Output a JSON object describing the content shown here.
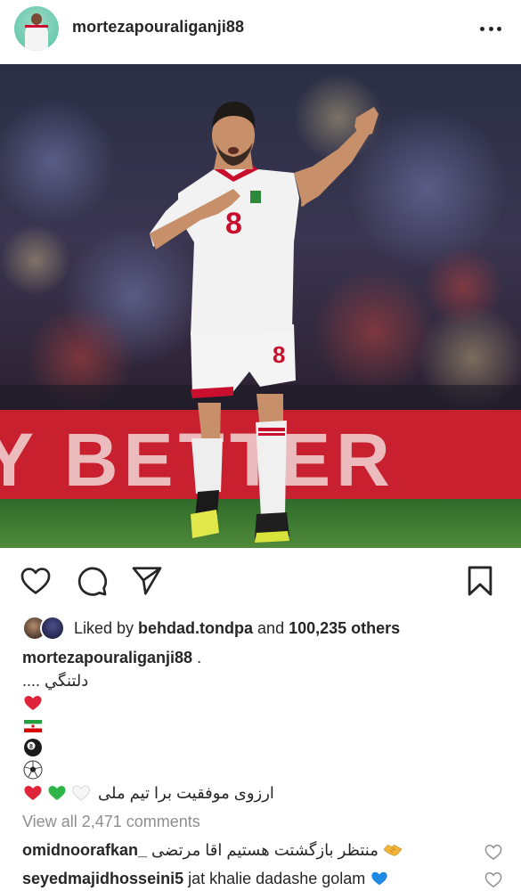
{
  "post": {
    "username": "mortezapouraliganji88",
    "more_icon": "more-horizontal-icon"
  },
  "photo": {
    "banner_text": "Y BETTER",
    "jersey_number": "8",
    "shorts_number": "8",
    "colors": {
      "banner": "#c8202f",
      "grass": "#3f7a33",
      "kit": "#f2f2f2",
      "kit_accent": "#c8102e"
    }
  },
  "actions": {
    "like_icon": "heart-icon",
    "comment_icon": "comment-icon",
    "share_icon": "send-icon",
    "save_icon": "bookmark-icon"
  },
  "likes": {
    "prefix": "Liked by ",
    "user": "behdad.tondpa",
    "middle": " and ",
    "count": "100,235 others"
  },
  "caption": {
    "username": "mortezapouraliganji88",
    "suffix": " .",
    "line1": "دلتنگي ....",
    "emojis": [
      "red-heart",
      "iran-flag",
      "pool-8-ball",
      "soccer-ball"
    ],
    "last_line_text": "ارزوی موفقیت برا تیم ملی"
  },
  "comments": {
    "view_all": "View all 2,471 comments",
    "items": [
      {
        "user": "omidnoorafkan_",
        "text": "منتظر بازگشتت هستیم اقا مرتضی"
      },
      {
        "user": "seyedmajidhosseini5",
        "text": "jat khalie dadashe golam"
      }
    ]
  }
}
